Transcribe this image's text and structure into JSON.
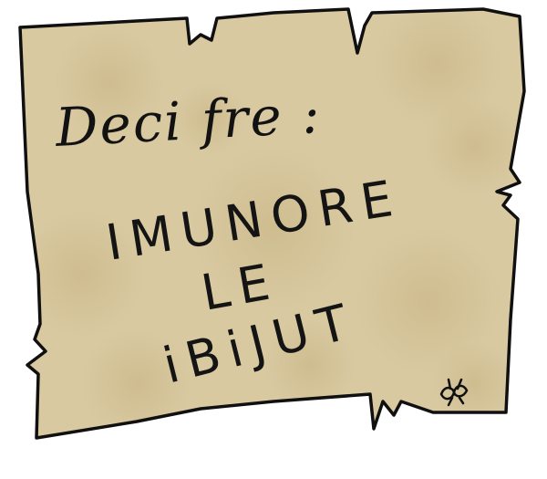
{
  "note": {
    "heading": "Deci fre :",
    "lines": [
      "IMUNORE",
      "LE",
      "iBiJUT"
    ]
  },
  "colors": {
    "paper": "#d9c9a1",
    "paper_shade": "#c9b788",
    "ink": "#111111"
  },
  "icons": {
    "signature": "bee-doodle-icon"
  }
}
